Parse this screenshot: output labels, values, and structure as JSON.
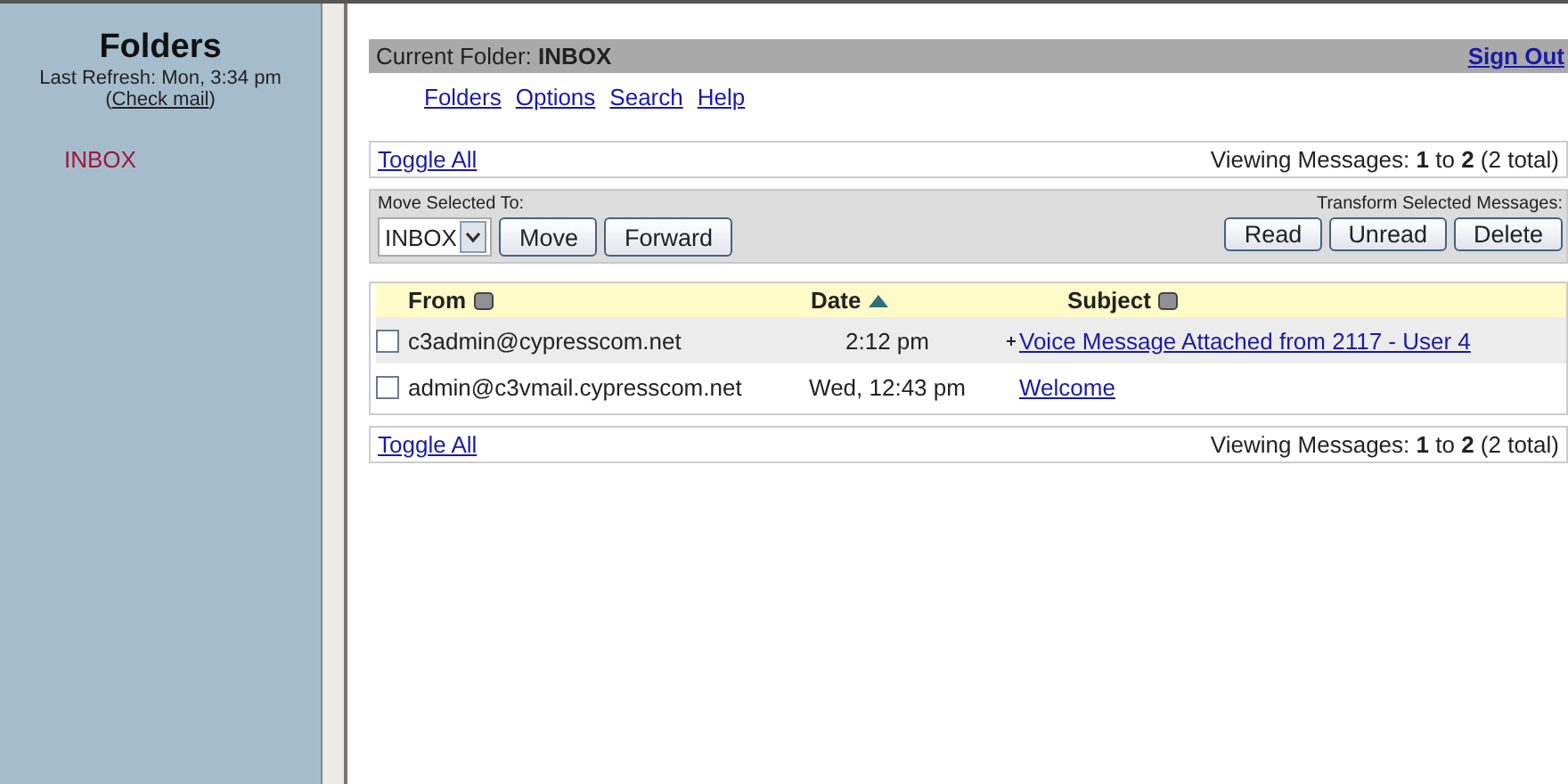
{
  "sidebar": {
    "title": "Folders",
    "refresh": "Last Refresh: Mon, 3:34 pm",
    "check_mail_open": "(",
    "check_mail": "Check mail",
    "check_mail_close": ")",
    "folders": [
      {
        "label": "INBOX",
        "selected": false
      }
    ]
  },
  "header": {
    "label": "Current Folder:",
    "folder": "INBOX",
    "sign_out": "Sign Out"
  },
  "nav": [
    "Folders",
    "Options",
    "Search",
    "Help"
  ],
  "top_bar": {
    "toggle": "Toggle All",
    "viewing": "Viewing Messages: **1** to **2** (2 total)"
  },
  "actions": {
    "move_label": "Move Selected To:",
    "folder_select": "INBOX",
    "move_buttons": [
      "Move",
      "Forward"
    ],
    "transform_label": "Transform Selected Messages:",
    "transform_buttons": [
      "Read",
      "Unread",
      "Delete"
    ]
  },
  "columns": [
    {
      "label": "From",
      "sorted": false
    },
    {
      "label": "Date",
      "sorted": true
    },
    {
      "label": "Subject",
      "sorted": false
    }
  ],
  "messages": [
    {
      "from": "c3admin@cypresscom.net",
      "date": "2:12 pm",
      "attachment": true,
      "subject": "Voice Message Attached from 2117 - User 4",
      "checked": false
    },
    {
      "from": "admin@c3vmail.cypresscom.net",
      "date": "Wed, 12:43 pm",
      "attachment": false,
      "subject": "Welcome",
      "checked": false
    }
  ],
  "bottom_bar": {
    "toggle": "Toggle All",
    "viewing": "Viewing Messages: **1** to **2** (2 total)"
  }
}
